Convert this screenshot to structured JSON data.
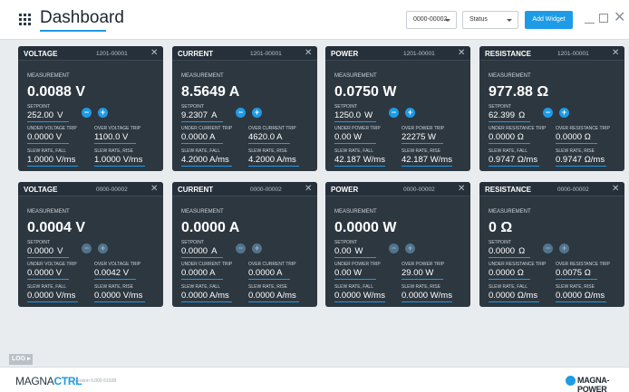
{
  "header": {
    "title": "Dashboard",
    "device_select": "0000-00002",
    "status_select": "Status",
    "add_widget": "Add Widget"
  },
  "colors": {
    "accent": "#1e9be6",
    "card_bg": "#2d3740",
    "page_bg": "#e9ecef"
  },
  "labels": {
    "measurement": "MEASUREMENT",
    "setpoint": "SETPOINT",
    "slew_fall": "SLEW RATE, FALL",
    "slew_rise": "SLEW RATE, RISE"
  },
  "widgets": [
    {
      "title": "VOLTAGE",
      "serial": "1201-00001",
      "measurement": "0.0088 V",
      "setpoint": "252.00",
      "setpoint_unit": "V",
      "under_label": "UNDER VOLTAGE TRIP",
      "under_value": "0.0000 V",
      "over_label": "OVER VOLTAGE TRIP",
      "over_value": "1100.0 V",
      "slew_fall": "1.0000 V/ms",
      "slew_rise": "1.0000 V/ms",
      "enabled": true
    },
    {
      "title": "CURRENT",
      "serial": "1201-00001",
      "measurement": "8.5649 A",
      "setpoint": "9.2307",
      "setpoint_unit": "A",
      "under_label": "UNDER CURRENT TRIP",
      "under_value": "0.0000 A",
      "over_label": "OVER CURRENT TRIP",
      "over_value": "4620.0 A",
      "slew_fall": "4.2000 A/ms",
      "slew_rise": "4.2000 A/ms",
      "enabled": true
    },
    {
      "title": "POWER",
      "serial": "1201-00001",
      "measurement": "0.0750 W",
      "setpoint": "1250.0",
      "setpoint_unit": "W",
      "under_label": "UNDER POWER TRIP",
      "under_value": "0.00    W",
      "over_label": "OVER POWER TRIP",
      "over_value": "22275  W",
      "slew_fall": "42.187 W/ms",
      "slew_rise": "42.187 W/ms",
      "enabled": true
    },
    {
      "title": "RESISTANCE",
      "serial": "1201-00001",
      "measurement": "977.88 Ω",
      "setpoint": "62.399",
      "setpoint_unit": "Ω",
      "under_label": "UNDER RESISTANCE TRIP",
      "under_value": "0.0000 Ω",
      "over_label": "OVER RESISTANCE TRIP",
      "over_value": "0.0000 Ω",
      "slew_fall": "0.9747 Ω/ms",
      "slew_rise": "0.9747 Ω/ms",
      "enabled": true
    },
    {
      "title": "VOLTAGE",
      "serial": "0000-00002",
      "measurement": "0.0004 V",
      "setpoint": "0.0000",
      "setpoint_unit": "V",
      "under_label": "UNDER VOLTAGE TRIP",
      "under_value": "0.0000 V",
      "over_label": "OVER VOLTAGE TRIP",
      "over_value": "0.0042 V",
      "slew_fall": "0.0000 V/ms",
      "slew_rise": "0.0000 V/ms",
      "enabled": false
    },
    {
      "title": "CURRENT",
      "serial": "0000-00002",
      "measurement": "0.0000 A",
      "setpoint": "0.0000",
      "setpoint_unit": "A",
      "under_label": "UNDER CURRENT TRIP",
      "under_value": "0.0000 A",
      "over_label": "OVER CURRENT TRIP",
      "over_value": "0.0000 A",
      "slew_fall": "0.0000 A/ms",
      "slew_rise": "0.0000 A/ms",
      "enabled": false
    },
    {
      "title": "POWER",
      "serial": "0000-00002",
      "measurement": "0.0000 W",
      "setpoint": "0.00",
      "setpoint_unit": "W",
      "under_label": "UNDER POWER TRIP",
      "under_value": "0.00    W",
      "over_label": "OVER POWER TRIP",
      "over_value": "29.00   W",
      "slew_fall": "0.0000 W/ms",
      "slew_rise": "0.0000 W/ms",
      "enabled": false
    },
    {
      "title": "RESISTANCE",
      "serial": "0000-00002",
      "measurement": "0 Ω",
      "setpoint": "0.0000",
      "setpoint_unit": "Ω",
      "under_label": "UNDER RESISTANCE TRIP",
      "under_value": "0.0000 Ω",
      "over_label": "OVER RESISTANCE TRIP",
      "over_value": "0.0075 Ω",
      "slew_fall": "0.0000 Ω/ms",
      "slew_rise": "0.0000 Ω/ms",
      "enabled": false
    }
  ],
  "log_label": "LOG ▸",
  "footer": {
    "brand_prefix": "MAGNA",
    "brand_suffix": "CTRL",
    "version": "Version 0.000-51028",
    "company": "MAGNA-POWER"
  },
  "window_controls": {
    "close": "✕"
  }
}
